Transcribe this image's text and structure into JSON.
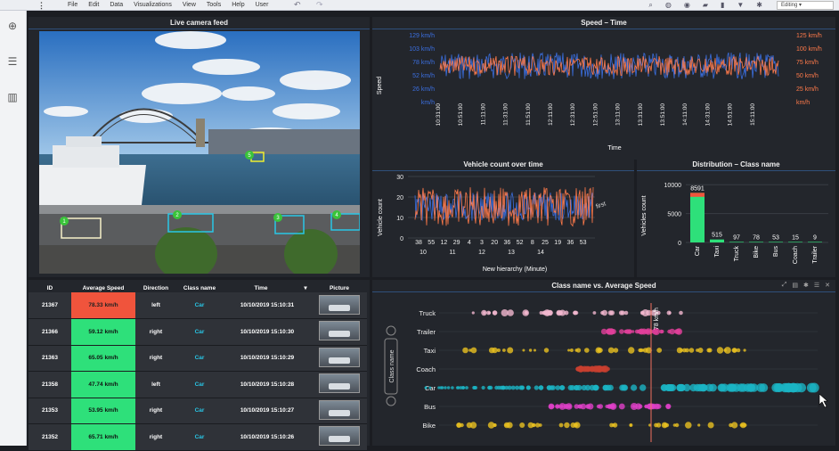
{
  "menu": [
    "File",
    "Edit",
    "Data",
    "Visualizations",
    "View",
    "Tools",
    "Help",
    "User"
  ],
  "mode": "Editing",
  "panels": {
    "camera": "Live camera feed",
    "speed_time": "Speed – Time",
    "vehicle_count": "Vehicle count over time",
    "distribution": "Distribution – Class name",
    "class_speed": "Class name vs. Average Speed"
  },
  "camera_labels": [
    "1",
    "2",
    "3",
    "4",
    "5"
  ],
  "table": {
    "headers": [
      "ID",
      "Average Speed",
      "Direction",
      "Class name",
      "Time",
      "",
      "Picture"
    ],
    "rows": [
      {
        "id": "21367",
        "speed": "78.33 km/h",
        "dir": "left",
        "cls": "Car",
        "time": "10/10/2019 15:10:31",
        "hot": true
      },
      {
        "id": "21366",
        "speed": "59.12 km/h",
        "dir": "right",
        "cls": "Car",
        "time": "10/10/2019 15:10:30",
        "hot": false
      },
      {
        "id": "21363",
        "speed": "65.05 km/h",
        "dir": "right",
        "cls": "Car",
        "time": "10/10/2019 15:10:29",
        "hot": false
      },
      {
        "id": "21358",
        "speed": "47.74 km/h",
        "dir": "left",
        "cls": "Car",
        "time": "10/10/2019 15:10:28",
        "hot": false
      },
      {
        "id": "21353",
        "speed": "53.95 km/h",
        "dir": "right",
        "cls": "Car",
        "time": "10/10/2019 15:10:27",
        "hot": false
      },
      {
        "id": "21352",
        "speed": "65.71 km/h",
        "dir": "right",
        "cls": "Car",
        "time": "10/10/2019 15:10:26",
        "hot": false
      }
    ]
  },
  "speed_chart": {
    "ylabel": "Speed",
    "xlabel": "Time",
    "left_ticks": [
      "129 km/h",
      "103 km/h",
      "78 km/h",
      "52 km/h",
      "26 km/h",
      "km/h"
    ],
    "right_ticks": [
      "125 km/h",
      "100 km/h",
      "75 km/h",
      "50 km/h",
      "25 km/h",
      "km/h"
    ],
    "x_ticks": [
      "10:31:00",
      "10:51:00",
      "11:11:00",
      "11:31:00",
      "11:51:00",
      "12:11:00",
      "12:31:00",
      "12:51:00",
      "13:11:00",
      "13:31:00",
      "13:51:00",
      "14:11:00",
      "14:31:00",
      "14:51:00",
      "15:11:00"
    ],
    "colors": {
      "a": "#3b6fe0",
      "b": "#ff7a4a"
    }
  },
  "count_chart": {
    "ylabel": "Vehicle count",
    "xlabel": "New hierarchy (Minute)",
    "y_ticks": [
      "30",
      "20",
      "10",
      "0"
    ],
    "minute_ticks": [
      "38",
      "55",
      "12",
      "29",
      "4",
      "3",
      "20",
      "36",
      "52",
      "8",
      "25",
      "19",
      "36",
      "53"
    ],
    "hour_ticks": [
      "10",
      "11",
      "12",
      "13",
      "14"
    ],
    "annotation": "first"
  },
  "chart_data": {
    "type": "bar",
    "categories": [
      "Car",
      "Taxi",
      "Truck",
      "Bike",
      "Bus",
      "Coach",
      "Trailer"
    ],
    "values": [
      8591,
      515,
      97,
      78,
      53,
      15,
      9
    ],
    "ylabel": "Vehicles count",
    "y_ticks": [
      0,
      5000,
      10000
    ],
    "ylim": [
      0,
      10500
    ],
    "highlight_color": "#f0543c",
    "bar_color": "#2ee07a"
  },
  "scatter": {
    "ylabel": "Class name",
    "classes": [
      "Truck",
      "Trailer",
      "Taxi",
      "Coach",
      "Car",
      "Bus",
      "Bike"
    ],
    "marker": "78 km/h",
    "colors": {
      "Truck": "#f2b8d0",
      "Trailer": "#e0409a",
      "Taxi": "#e8c020",
      "Coach": "#c84030",
      "Car": "#1ab4c4",
      "Bus": "#e040c8",
      "Bike": "#e8c020"
    }
  }
}
